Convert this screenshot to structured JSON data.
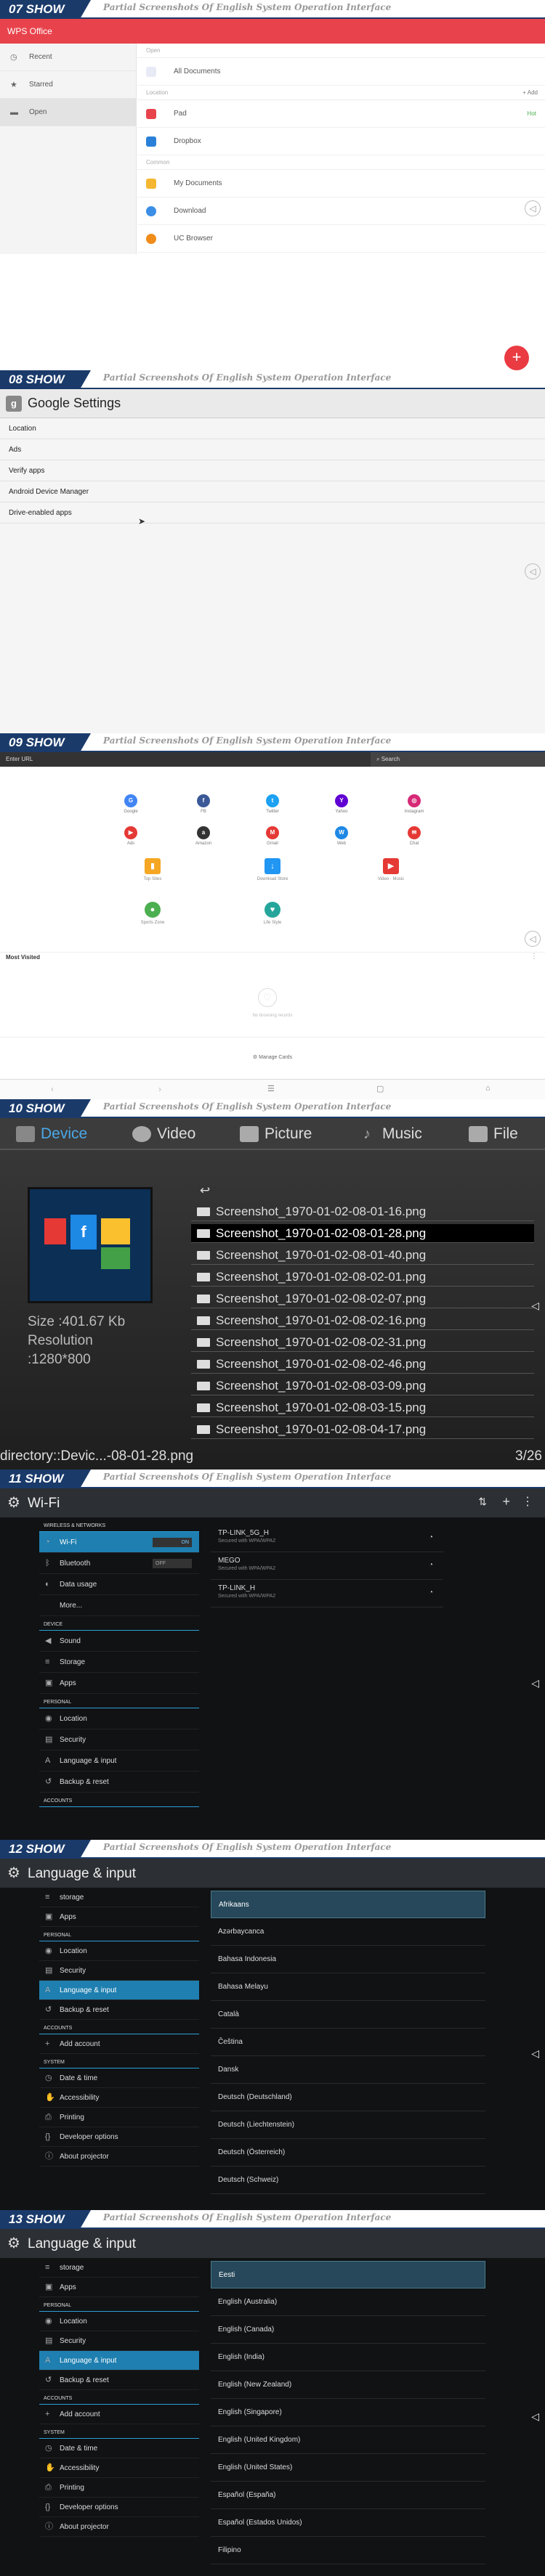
{
  "caption": "Partial Screenshots Of English System Operation Interface",
  "banners": [
    "07 SHOW",
    "08 SHOW",
    "09 SHOW",
    "10 SHOW",
    "11 SHOW",
    "12 SHOW",
    "13 SHOW"
  ],
  "wps": {
    "title": "WPS Office",
    "side": [
      "Recent",
      "Starred",
      "Open"
    ],
    "open_hdr": "Open",
    "all_docs": "All Documents",
    "location_hdr": "Location",
    "add": "+ Add",
    "pad": "Pad",
    "pad_badge": "Hot",
    "dropbox": "Dropbox",
    "common_hdr": "Common",
    "my_docs": "My Documents",
    "download": "Download",
    "uc": "UC Browser",
    "fab": "+"
  },
  "google": {
    "title": "Google Settings",
    "items": [
      "Location",
      "Ads",
      "Verify apps",
      "Android Device Manager",
      "Drive-enabled apps"
    ]
  },
  "browser": {
    "url_placeholder": "Enter URL",
    "search": "Search",
    "icons": [
      {
        "label": "Google",
        "color": "#4285f4",
        "g": "G"
      },
      {
        "label": "FB",
        "color": "#3b5998",
        "g": "f"
      },
      {
        "label": "Twitter",
        "color": "#1da1f2",
        "g": "t"
      },
      {
        "label": "Yahoo",
        "color": "#6001d2",
        "g": "Y"
      },
      {
        "label": "Instagram",
        "color": "#d62976",
        "g": "◎"
      },
      {
        "label": "Ads",
        "color": "#e53935",
        "g": "▶"
      },
      {
        "label": "Amazon",
        "color": "#333333",
        "g": "a"
      },
      {
        "label": "Gmail",
        "color": "#e53935",
        "g": "M"
      },
      {
        "label": "Web",
        "color": "#1e88e5",
        "g": "W"
      },
      {
        "label": "Chat",
        "color": "#e53935",
        "g": "✉"
      }
    ],
    "big": [
      {
        "label": "Top Sites",
        "color": "#f5a623",
        "g": "▮"
      },
      {
        "label": "Download Store",
        "color": "#2196f3",
        "g": "↓"
      },
      {
        "label": "Video · Music",
        "color": "#e53935",
        "g": "▶"
      },
      {
        "label": "Sports Zone",
        "color": "#4caf50",
        "g": "●"
      },
      {
        "label": "Life Style",
        "color": "#26a69a",
        "g": "♥"
      }
    ],
    "most_visited": "Most Visited",
    "no_fav": "No browsing records",
    "manage": "Manage Cards"
  },
  "filemgr": {
    "tabs": [
      "Device",
      "Video",
      "Picture",
      "Music",
      "File"
    ],
    "size": "Size :401.67 Kb",
    "resolution": "Resolution",
    "res_val": ":1280*800",
    "back": "↩",
    "files": [
      "Screenshot_1970-01-02-08-01-16.png",
      "Screenshot_1970-01-02-08-01-28.png",
      "Screenshot_1970-01-02-08-01-40.png",
      "Screenshot_1970-01-02-08-02-01.png",
      "Screenshot_1970-01-02-08-02-07.png",
      "Screenshot_1970-01-02-08-02-16.png",
      "Screenshot_1970-01-02-08-02-31.png",
      "Screenshot_1970-01-02-08-02-46.png",
      "Screenshot_1970-01-02-08-03-09.png",
      "Screenshot_1970-01-02-08-03-15.png",
      "Screenshot_1970-01-02-08-04-17.png"
    ],
    "selected_index": 1,
    "path": "directory::Devic...-08-01-28.png",
    "count": "3/26"
  },
  "wifi": {
    "title": "Wi-Fi",
    "hdr_wireless": "WIRELESS & NETWORKS",
    "wifi": "Wi-Fi",
    "wifi_state": "ON",
    "bluetooth": "Bluetooth",
    "bt_state": "OFF",
    "data": "Data usage",
    "more": "More...",
    "hdr_device": "DEVICE",
    "sound": "Sound",
    "storage": "Storage",
    "apps": "Apps",
    "hdr_personal": "PERSONAL",
    "location": "Location",
    "security": "Security",
    "lang": "Language & input",
    "backup": "Backup & reset",
    "hdr_accounts": "ACCOUNTS",
    "networks": [
      {
        "name": "TP-LINK_5G_H",
        "sub": "Secured with WPA/WPA2"
      },
      {
        "name": "MEGO",
        "sub": "Secured with WPA/WPA2"
      },
      {
        "name": "TP-LINK_H",
        "sub": "Secured with WPA/WPA2"
      }
    ]
  },
  "lang1": {
    "title": "Language & input",
    "side": [
      "storage",
      "Apps",
      "PERSONAL",
      "Location",
      "Security",
      "Language & input",
      "Backup & reset",
      "ACCOUNTS",
      "Add account",
      "SYSTEM",
      "Date & time",
      "Accessibility",
      "Printing",
      "Developer options",
      "About projector"
    ],
    "list": [
      "Afrikaans",
      "Azərbaycanca",
      "Bahasa Indonesia",
      "Bahasa Melayu",
      "Català",
      "Čeština",
      "Dansk",
      "Deutsch (Deutschland)",
      "Deutsch (Liechtenstein)",
      "Deutsch (Österreich)",
      "Deutsch (Schweiz)"
    ]
  },
  "lang2": {
    "title": "Language & input",
    "list": [
      "Eesti",
      "English (Australia)",
      "English (Canada)",
      "English (India)",
      "English (New Zealand)",
      "English (Singapore)",
      "English (United Kingdom)",
      "English (United States)",
      "Español (España)",
      "Español (Estados Unidos)",
      "Filipino"
    ]
  }
}
